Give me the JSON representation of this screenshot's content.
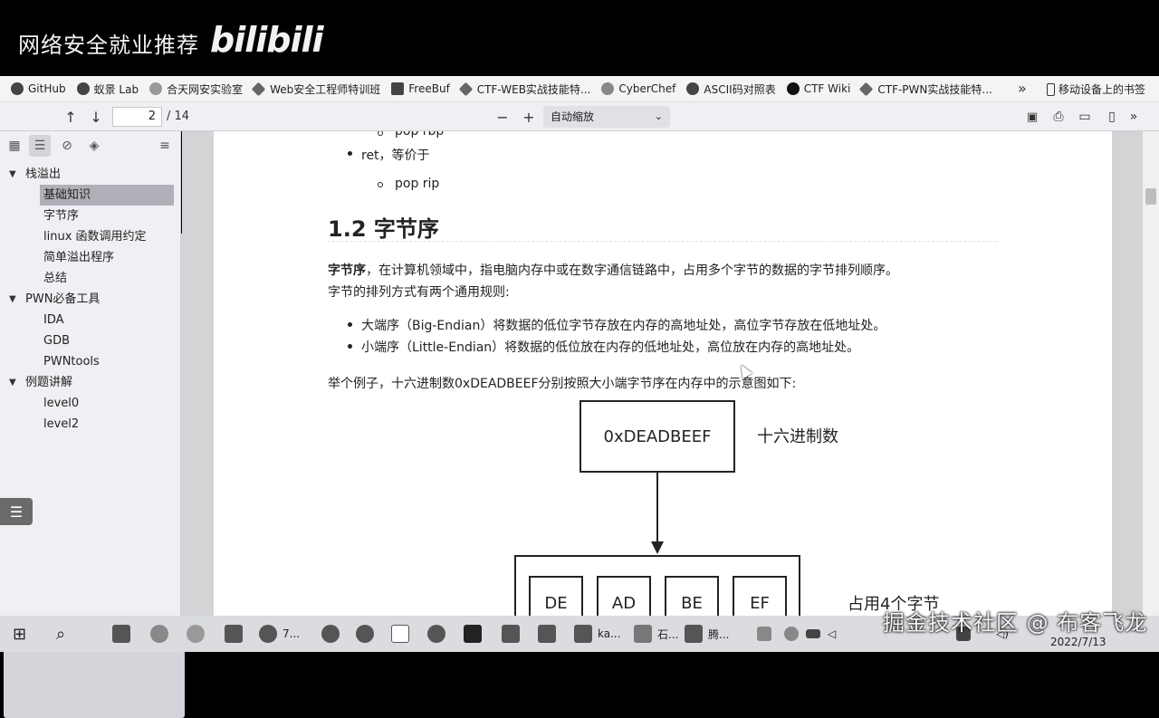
{
  "video": {
    "title": "网络安全就业推荐",
    "logo": "bilibili",
    "watermark": "掘金技术社区 @ 布客飞龙"
  },
  "bookmarks": {
    "items": [
      {
        "label": "GitHub",
        "icon": "github-icon"
      },
      {
        "label": "蚁景 Lab",
        "icon": "site-icon"
      },
      {
        "label": "合天网安实验室",
        "icon": "shield-icon"
      },
      {
        "label": "Web安全工程师特训班",
        "icon": "site-icon"
      },
      {
        "label": "FreeBuf",
        "icon": "site-icon"
      },
      {
        "label": "CTF-WEB实战技能特...",
        "icon": "site-icon"
      },
      {
        "label": "CyberChef",
        "icon": "site-icon"
      },
      {
        "label": "ASCII码对照表",
        "icon": "site-icon"
      },
      {
        "label": "CTF Wiki",
        "icon": "site-icon"
      },
      {
        "label": "CTF-PWN实战技能特...",
        "icon": "site-icon"
      }
    ],
    "more": "»",
    "mobile_label": "移动设备上的书签"
  },
  "toolbar": {
    "page_current": "2",
    "page_total": "/ 14",
    "zoom_option": "自动缩放",
    "zoom_out": "−",
    "zoom_in": "+"
  },
  "outline": {
    "items": [
      {
        "label": "栈溢出",
        "level": 1,
        "expanded": true
      },
      {
        "label": "基础知识",
        "level": 2,
        "selected": true
      },
      {
        "label": "字节序",
        "level": 2
      },
      {
        "label": "linux 函数调用约定",
        "level": 2
      },
      {
        "label": "简单溢出程序",
        "level": 2
      },
      {
        "label": "总结",
        "level": 2
      },
      {
        "label": "PWN必备工具",
        "level": 1,
        "expanded": true
      },
      {
        "label": "IDA",
        "level": 2
      },
      {
        "label": "GDB",
        "level": 2
      },
      {
        "label": "PWNtools",
        "level": 2
      },
      {
        "label": "例题讲解",
        "level": 1,
        "expanded": true
      },
      {
        "label": "level0",
        "level": 2
      },
      {
        "label": "level2",
        "level": 2
      }
    ]
  },
  "document": {
    "clipped_line": "pop rbp",
    "ret_line": "ret，等价于",
    "pop_rip": "pop rip",
    "heading": "1.2 字节序",
    "para_bold": "字节序",
    "para_rest": "，在计算机领域中，指电脑内存中或在数字通信链路中，占用多个字节的数据的字节排列顺序。",
    "para_line2": "字节的排列方式有两个通用规则:",
    "big_endian": "大端序（Big-Endian）将数据的低位字节存放在内存的高地址处，高位字节存放在低地址处。",
    "little_endian": "小端序（Little-Endian）将数据的低位放在内存的低地址处，高位放在内存的高地址处。",
    "example": "举个例子，十六进制数0xDEADBEEF分别按照大小端字节序在内存中的示意图如下:"
  },
  "diagram": {
    "top_box": "0xDEADBEEF",
    "top_label": "十六进制数",
    "bytes": [
      "DE",
      "AD",
      "BE",
      "EF"
    ],
    "bytes_label": "占用4个字节"
  },
  "taskbar": {
    "items": [
      "7...",
      "ka...",
      "石...",
      "腾..."
    ],
    "date": "2022/7/13"
  }
}
